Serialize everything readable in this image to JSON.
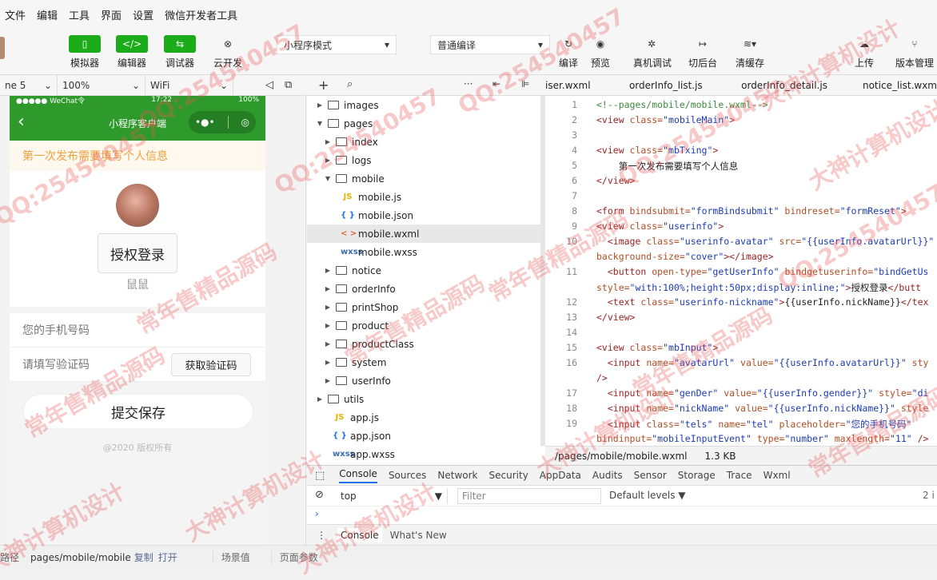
{
  "menu": [
    "文件",
    "编辑",
    "工具",
    "界面",
    "设置",
    "微信开发者工具"
  ],
  "toolbar": {
    "simulator": "模拟器",
    "editor": "编辑器",
    "debugger": "调试器",
    "cloud": "云开发",
    "mode_select": "小程序模式",
    "compile_select": "普通编译",
    "compile": "编译",
    "preview": "预览",
    "real_debug": "真机调试",
    "background": "切后台",
    "clear_cache": "清缓存",
    "upload": "上传",
    "version": "版本管理"
  },
  "simbar": {
    "device": "ne 5",
    "zoom": "100%",
    "network": "WiFi"
  },
  "phone": {
    "status_left": "●●●●● WeChat令",
    "status_time": "17:22",
    "status_right": "100%",
    "nav_title": "小程序客户端",
    "tip": "第一次发布需要填写个人信息",
    "auth_button": "授权登录",
    "nickname": "鼠鼠",
    "phone_placeholder": "您的手机号码",
    "code_placeholder": "请填写验证码",
    "code_button": "获取验证码",
    "save_button": "提交保存",
    "copyright": "@2020 版权所有"
  },
  "tree": [
    {
      "name": "images",
      "type": "folder",
      "depth": 0,
      "open": false
    },
    {
      "name": "pages",
      "type": "folder",
      "depth": 0,
      "open": true
    },
    {
      "name": "index",
      "type": "folder",
      "depth": 1,
      "open": false
    },
    {
      "name": "logs",
      "type": "folder",
      "depth": 1,
      "open": false
    },
    {
      "name": "mobile",
      "type": "folder",
      "depth": 1,
      "open": true
    },
    {
      "name": "mobile.js",
      "type": "js",
      "depth": 2
    },
    {
      "name": "mobile.json",
      "type": "json",
      "depth": 2
    },
    {
      "name": "mobile.wxml",
      "type": "wxml",
      "depth": 2,
      "selected": true
    },
    {
      "name": "mobile.wxss",
      "type": "wxss",
      "depth": 2
    },
    {
      "name": "notice",
      "type": "folder",
      "depth": 1,
      "open": false
    },
    {
      "name": "orderInfo",
      "type": "folder",
      "depth": 1,
      "open": false
    },
    {
      "name": "printShop",
      "type": "folder",
      "depth": 1,
      "open": false
    },
    {
      "name": "product",
      "type": "folder",
      "depth": 1,
      "open": false
    },
    {
      "name": "productClass",
      "type": "folder",
      "depth": 1,
      "open": false
    },
    {
      "name": "system",
      "type": "folder",
      "depth": 1,
      "open": false
    },
    {
      "name": "userInfo",
      "type": "folder",
      "depth": 1,
      "open": false
    },
    {
      "name": "utils",
      "type": "folder",
      "depth": 0,
      "open": false
    },
    {
      "name": "app.js",
      "type": "js",
      "depth": 1
    },
    {
      "name": "app.json",
      "type": "json",
      "depth": 1
    },
    {
      "name": "app.wxss",
      "type": "wxss",
      "depth": 1
    }
  ],
  "file_icons": {
    "js": "JS",
    "json": "{ }",
    "wxml": "< >",
    "wxss": "wxss"
  },
  "editor_tabs": [
    "iser.wxml",
    "orderInfo_list.js",
    "orderInfo_detail.js",
    "notice_list.wxm"
  ],
  "code_lines": [
    {
      "n": "1",
      "segs": [
        [
          "cm",
          "<!--pages/mobile/mobile.wxml-->"
        ]
      ]
    },
    {
      "n": "2",
      "segs": [
        [
          "tag",
          "<view "
        ],
        [
          "at",
          "class="
        ],
        [
          "st",
          "\"mobileMain\""
        ],
        [
          "tag",
          ">"
        ]
      ]
    },
    {
      "n": "3",
      "segs": []
    },
    {
      "n": "4",
      "segs": [
        [
          "tag",
          "<view "
        ],
        [
          "at",
          "class="
        ],
        [
          "st",
          "\"mbTxing\""
        ],
        [
          "tag",
          ">"
        ]
      ]
    },
    {
      "n": "5",
      "segs": [
        [
          "tx",
          "    第一次发布需要填写个人信息"
        ]
      ]
    },
    {
      "n": "6",
      "segs": [
        [
          "tag",
          "</view>"
        ]
      ]
    },
    {
      "n": "7",
      "segs": []
    },
    {
      "n": "8",
      "segs": [
        [
          "tag",
          "<form "
        ],
        [
          "at",
          "bindsubmit="
        ],
        [
          "st",
          "\"formBindsubmit\" "
        ],
        [
          "at",
          "bindreset="
        ],
        [
          "st",
          "\"formReset\""
        ],
        [
          "tag",
          ">"
        ]
      ]
    },
    {
      "n": "9",
      "segs": [
        [
          "tag",
          "<view "
        ],
        [
          "at",
          "class="
        ],
        [
          "st",
          "\"userinfo\""
        ],
        [
          "tag",
          ">"
        ]
      ]
    },
    {
      "n": "10",
      "segs": [
        [
          "tag",
          "  <image "
        ],
        [
          "at",
          "class="
        ],
        [
          "st",
          "\"userinfo-avatar\" "
        ],
        [
          "at",
          "src="
        ],
        [
          "st",
          "\"{{userInfo.avatarUrl}}\""
        ]
      ]
    },
    {
      "n": "",
      "segs": [
        [
          "at",
          "background-size="
        ],
        [
          "st",
          "\"cover\""
        ],
        [
          "tag",
          "></image>"
        ]
      ]
    },
    {
      "n": "11",
      "segs": [
        [
          "tag",
          "  <button "
        ],
        [
          "at",
          "open-type="
        ],
        [
          "st",
          "\"getUserInfo\" "
        ],
        [
          "at",
          "bindgetuserinfo="
        ],
        [
          "st",
          "\"bindGetUs"
        ]
      ]
    },
    {
      "n": "",
      "segs": [
        [
          "at",
          "style="
        ],
        [
          "st",
          "\"with:100%;height:50px;display:inline;\""
        ],
        [
          "tag",
          ">"
        ],
        [
          "tx",
          "授权登录"
        ],
        [
          "tag",
          "</butt"
        ]
      ]
    },
    {
      "n": "12",
      "segs": [
        [
          "tag",
          "  <text "
        ],
        [
          "at",
          "class="
        ],
        [
          "st",
          "\"userinfo-nickname\""
        ],
        [
          "tag",
          ">"
        ],
        [
          "tx",
          "{{userInfo.nickName}}"
        ],
        [
          "tag",
          "</tex"
        ]
      ]
    },
    {
      "n": "13",
      "segs": [
        [
          "tag",
          "</view>"
        ]
      ]
    },
    {
      "n": "14",
      "segs": []
    },
    {
      "n": "15",
      "segs": [
        [
          "tag",
          "<view "
        ],
        [
          "at",
          "class="
        ],
        [
          "st",
          "\"mbInput\""
        ],
        [
          "tag",
          ">"
        ]
      ]
    },
    {
      "n": "16",
      "segs": [
        [
          "tag",
          "  <input "
        ],
        [
          "at",
          "name="
        ],
        [
          "st",
          "\"avatarUrl\" "
        ],
        [
          "at",
          "value="
        ],
        [
          "st",
          "\"{{userInfo.avatarUrl}}\" "
        ],
        [
          "at",
          "sty"
        ]
      ]
    },
    {
      "n": "",
      "segs": [
        [
          "tag",
          "/>"
        ]
      ]
    },
    {
      "n": "17",
      "segs": [
        [
          "tag",
          "  <input "
        ],
        [
          "at",
          "name="
        ],
        [
          "st",
          "\"genDer\" "
        ],
        [
          "at",
          "value="
        ],
        [
          "st",
          "\"{{userInfo.gender}}\" "
        ],
        [
          "at",
          "style="
        ],
        [
          "st",
          "\"di"
        ]
      ]
    },
    {
      "n": "18",
      "segs": [
        [
          "tag",
          "  <input "
        ],
        [
          "at",
          "name="
        ],
        [
          "st",
          "\"nickName\" "
        ],
        [
          "at",
          "value="
        ],
        [
          "st",
          "\"{{userInfo.nickName}}\" "
        ],
        [
          "at",
          "style"
        ]
      ]
    },
    {
      "n": "19",
      "segs": [
        [
          "tag",
          "  <input "
        ],
        [
          "at",
          "class="
        ],
        [
          "st",
          "\"tels\" "
        ],
        [
          "at",
          "name="
        ],
        [
          "st",
          "\"tel\" "
        ],
        [
          "at",
          "placeholder="
        ],
        [
          "st",
          "\"您的手机号码\""
        ]
      ]
    },
    {
      "n": "",
      "segs": [
        [
          "at",
          "bindinput="
        ],
        [
          "st",
          "\"mobileInputEvent\" "
        ],
        [
          "at",
          "type="
        ],
        [
          "st",
          "\"number\" "
        ],
        [
          "at",
          "maxlength="
        ],
        [
          "st",
          "\"11\" "
        ],
        [
          "tag",
          "/>"
        ]
      ]
    }
  ],
  "editor_status": {
    "path": "/pages/mobile/mobile.wxml",
    "size": "1.3 KB"
  },
  "devtools": {
    "tabs": [
      "Console",
      "Sources",
      "Network",
      "Security",
      "AppData",
      "Audits",
      "Sensor",
      "Storage",
      "Trace",
      "Wxml"
    ],
    "active": "Console",
    "context": "top",
    "filter_placeholder": "Filter",
    "levels": "Default levels",
    "count": "2 i",
    "drawer_tabs": [
      "Console",
      "What's New"
    ]
  },
  "bottombar": {
    "path_label": "路径",
    "path": "pages/mobile/mobile",
    "copy": "复制",
    "open": "打开",
    "scene": "场景值",
    "params": "页面参数"
  },
  "watermarks": [
    "QQ:254540457",
    "常年售精品源码",
    "大神计算机设计"
  ],
  "colors": {
    "brand_green": "#1aad19",
    "nav_green": "#2d9a2b",
    "tip_text": "#f0a13c",
    "active_tab": "#1a73e8"
  }
}
